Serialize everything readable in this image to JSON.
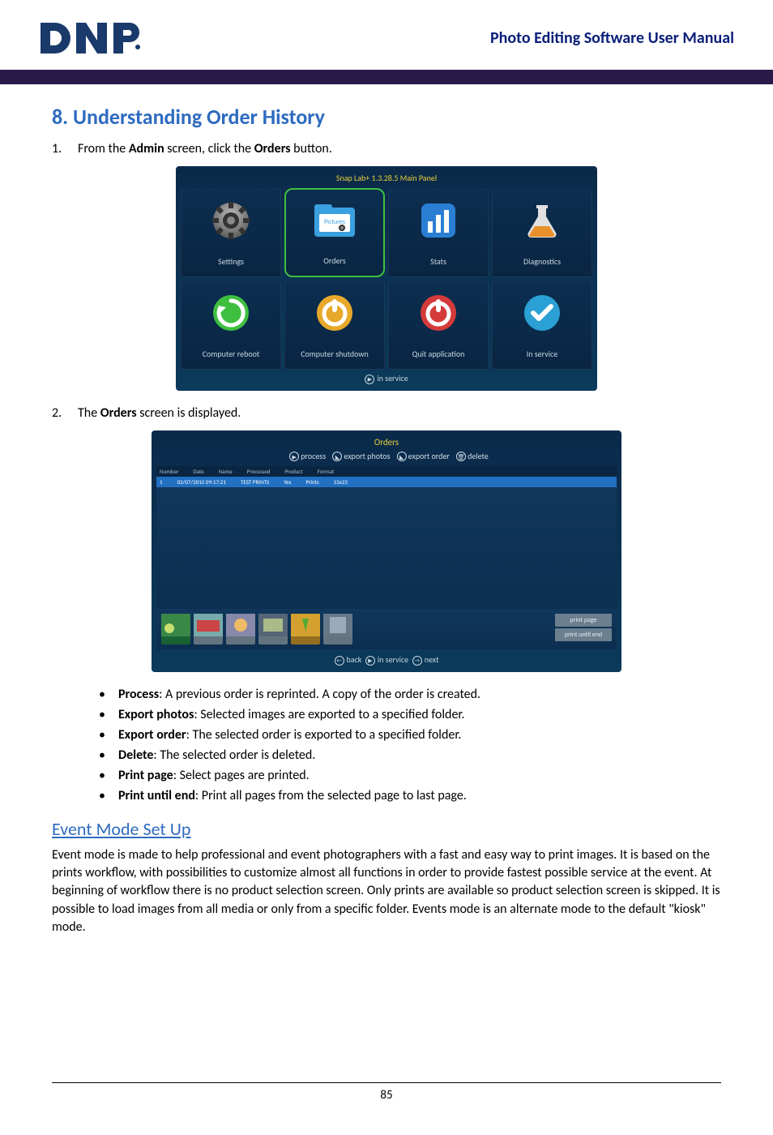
{
  "header": {
    "logo": "DNP",
    "doc_title": "Photo Editing Software User Manual"
  },
  "section": {
    "number": "8.",
    "title": "Understanding Order History"
  },
  "steps": [
    {
      "num": "1.",
      "pre": "From the ",
      "b1": "Admin",
      "mid": " screen, click the ",
      "b2": "Orders",
      "post": " button."
    },
    {
      "num": "2.",
      "pre": "The ",
      "b1": "Orders",
      "mid": "",
      "b2": "",
      "post": " screen is displayed."
    }
  ],
  "admin_panel": {
    "title": "Snap Lab+ 1.3.28.5 Main Panel",
    "cells": [
      {
        "label": "Settings"
      },
      {
        "label": "Orders"
      },
      {
        "label": "Stats"
      },
      {
        "label": "Diagnostics"
      },
      {
        "label": "Computer reboot"
      },
      {
        "label": "Computer shutdown"
      },
      {
        "label": "Quit application"
      },
      {
        "label": "In service"
      }
    ],
    "footer": "in service"
  },
  "orders_panel": {
    "title": "Orders",
    "actions": [
      "process",
      "export photos",
      "export order",
      "delete"
    ],
    "header_cols": [
      "Number",
      "Date",
      "Name",
      "Processed",
      "Product",
      "Format"
    ],
    "row": [
      "1",
      "02/07/2015 09:17:21",
      "TEST PRINTS",
      "Yes",
      "Prints",
      "—",
      "15x23"
    ],
    "side_buttons": [
      "print page",
      "print until end"
    ],
    "footer": [
      "back",
      "in service",
      "next"
    ]
  },
  "bullets": [
    {
      "b": "Process",
      "t": ": A previous order is reprinted. A copy of the order is created."
    },
    {
      "b": "Export photos",
      "t": ": Selected images are exported to a specified folder."
    },
    {
      "b": "Export order",
      "t": ": The selected order is exported to a specified folder."
    },
    {
      "b": "Delete",
      "t": ": The selected order is deleted."
    },
    {
      "b": "Print page",
      "t": ": Select pages are printed."
    },
    {
      "b": "Print until end",
      "t": ": Print all pages from the selected page to last page."
    }
  ],
  "subsection": {
    "title": "Event Mode Set Up",
    "para": "Event mode is made to help professional and event photographers with a fast and easy way to print images. It is based on the prints workflow, with possibilities to customize almost all functions in order to provide fastest possible service at the event. At beginning of workflow there is no product selection screen. Only prints are available so product selection screen is skipped. It is possible to load images from all media or only from a specific folder. Events mode is an alternate mode to the default \"kiosk\" mode."
  },
  "page_number": "85"
}
